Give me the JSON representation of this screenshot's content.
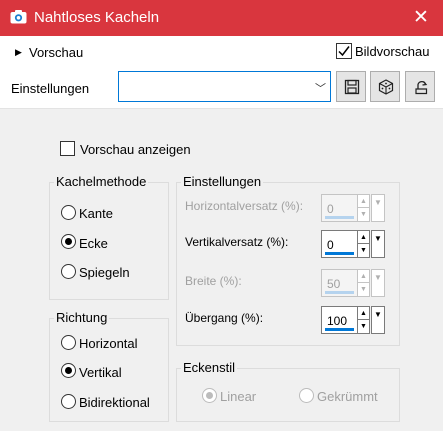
{
  "window": {
    "title": "Nahtloses Kacheln",
    "close_symbol": "✕"
  },
  "preview_bar": {
    "label": "Vorschau",
    "bild_label": "Bildvorschau",
    "bild_checked": true
  },
  "settings_row": {
    "label": "Einstellungen",
    "preset_value": ""
  },
  "preview_toggle": {
    "label": "Vorschau anzeigen",
    "checked": false
  },
  "kachel": {
    "title": "Kachelmethode",
    "options": [
      {
        "label": "Kante",
        "checked": false
      },
      {
        "label": "Ecke",
        "checked": true
      },
      {
        "label": "Spiegeln",
        "checked": false
      }
    ]
  },
  "richtung": {
    "title": "Richtung",
    "options": [
      {
        "label": "Horizontal",
        "checked": false
      },
      {
        "label": "Vertikal",
        "checked": true
      },
      {
        "label": "Bidirektional",
        "checked": false
      }
    ]
  },
  "einstellungen": {
    "title": "Einstellungen",
    "fields": [
      {
        "label": "Horizontalversatz (%):",
        "value": "0",
        "enabled": false
      },
      {
        "label": "Vertikalversatz (%):",
        "value": "0",
        "enabled": true
      },
      {
        "label": "Breite (%):",
        "value": "50",
        "enabled": false
      },
      {
        "label": "Übergang (%):",
        "value": "100",
        "enabled": true
      }
    ]
  },
  "eckenstil": {
    "title": "Eckenstil",
    "options": [
      {
        "label": "Linear",
        "checked": true,
        "enabled": false
      },
      {
        "label": "Gekrümmt",
        "checked": false,
        "enabled": false
      }
    ]
  },
  "colors": {
    "title_bar": "#d9363e",
    "accent": "#0078d7",
    "background": "#f0f0f0"
  }
}
